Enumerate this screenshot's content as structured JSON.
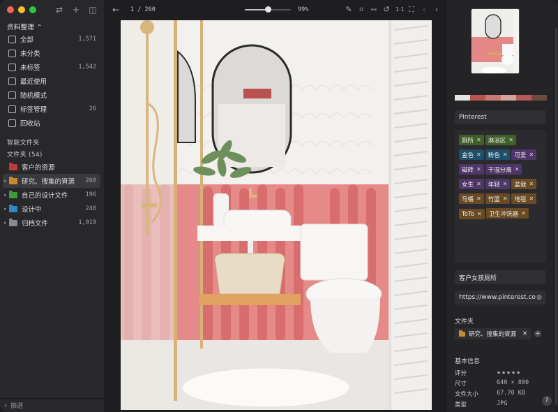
{
  "sidebar": {
    "library_title": "资料整理 ⌃",
    "items": [
      {
        "label": "全部",
        "count": "1,571",
        "icon": "all-items-icon"
      },
      {
        "label": "未分类",
        "count": "",
        "icon": "uncategorized-icon"
      },
      {
        "label": "未标签",
        "count": "1,542",
        "icon": "untagged-icon"
      },
      {
        "label": "最近使用",
        "count": "",
        "icon": "recent-icon"
      },
      {
        "label": "随机模式",
        "count": "",
        "icon": "random-icon"
      },
      {
        "label": "标签管理",
        "count": "26",
        "icon": "tag-manager-icon"
      },
      {
        "label": "回收站",
        "count": "",
        "icon": "trash-icon"
      }
    ],
    "smart_folders_title": "智能文件夹",
    "folders_title": "文件夹 (54)",
    "folders": [
      {
        "label": "客户的资源",
        "count": "",
        "color": "#c0393b",
        "caret": ""
      },
      {
        "label": "研究、搜集的資源",
        "count": "260",
        "color": "#c98a2f",
        "caret": "▸"
      },
      {
        "label": "自己的设计文件",
        "count": "196",
        "color": "#3d9a3d",
        "caret": "▸"
      },
      {
        "label": "设计中",
        "count": "248",
        "color": "#2f88c6",
        "caret": "▸"
      },
      {
        "label": "归档文件",
        "count": "1,019",
        "color": "#8a8a8e",
        "caret": "▸"
      }
    ],
    "filter_placeholder": "篩選"
  },
  "toolbar": {
    "pager": "1 / 260",
    "zoom": "99%",
    "zoom_fraction": 0.5
  },
  "inspector": {
    "palette": [
      "#e6e2df",
      "#b8534f",
      "#c97a76",
      "#d7a09c",
      "#b45a58",
      "#6c4a3c"
    ],
    "source": "Pinterest",
    "tags": [
      {
        "label": "厕所",
        "color": "#3f5e2a"
      },
      {
        "label": "淋浴区",
        "color": "#3f5e2a"
      },
      {
        "label": "金色",
        "color": "#1f4f68"
      },
      {
        "label": "粉色",
        "color": "#1f4f68"
      },
      {
        "label": "可爱",
        "color": "#4f3569"
      },
      {
        "label": "磁砖",
        "color": "#4f3569"
      },
      {
        "label": "干湿分离",
        "color": "#4f3569"
      },
      {
        "label": "女生",
        "color": "#4f3569"
      },
      {
        "label": "年轻",
        "color": "#4f3569"
      },
      {
        "label": "盆栽",
        "color": "#6a4a22"
      },
      {
        "label": "马桶",
        "color": "#6a4a22"
      },
      {
        "label": "竹篮",
        "color": "#6a4a22"
      },
      {
        "label": "地毯",
        "color": "#6a4a22"
      },
      {
        "label": "ToTo",
        "color": "#6a4a22"
      },
      {
        "label": "卫生冲洗器",
        "color": "#6a4a22"
      }
    ],
    "note": "客户女孩厕所",
    "url": "https://www.pinterest.co",
    "folder_section": "文件夹",
    "folder_chip": "研究、搜集的資源",
    "basic_info_title": "基本信息",
    "info": [
      {
        "key": "评分",
        "value": "★★★★★"
      },
      {
        "key": "尺寸",
        "value": "640 × 800"
      },
      {
        "key": "文件大小",
        "value": "67.70 KB"
      },
      {
        "key": "类型",
        "value": "JPG"
      }
    ],
    "rating": 5
  }
}
